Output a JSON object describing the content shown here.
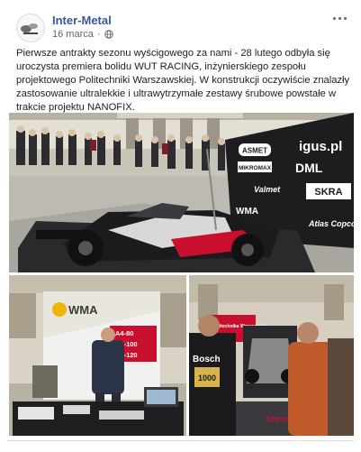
{
  "post": {
    "author": "Inter-Metal",
    "date": "16 marca",
    "date_separator": "·",
    "privacy_icon": "globe-icon",
    "more_icon": "more-horizontal-icon",
    "text": "Pierwsze antrakty sezonu wyścigowego za nami - 28 lutego odbyła się uroczysta premiera bolidu WUT RACING, inżynierskiego zespołu projektowego Politechniki Warszawskiej. W konstrukcji oczywiście znalazły zastosowanie ultralekkie i ultrawytrzymałe zestawy śrubowe powstałe w trakcie projektu NANOFIX."
  },
  "photo_main": {
    "sponsor_logos": [
      "ASMET",
      "igus.pl",
      "MIKROMAX",
      "DML",
      "Valmet",
      "SKRA",
      "WMA",
      "Atlas Copco"
    ]
  },
  "photo_left": {
    "brand": "WMA",
    "specs": [
      "A4-80",
      "A4-100",
      "A4-120"
    ]
  },
  "photo_right": {
    "banner": "Politechnika Warszawska",
    "tshirt": "Bosch",
    "tshirt_sub": "1000",
    "floor_text": "SzampTec"
  },
  "colors": {
    "link": "#385898",
    "meta": "#606770",
    "text": "#1c1e21",
    "accent_red": "#c8102e"
  }
}
